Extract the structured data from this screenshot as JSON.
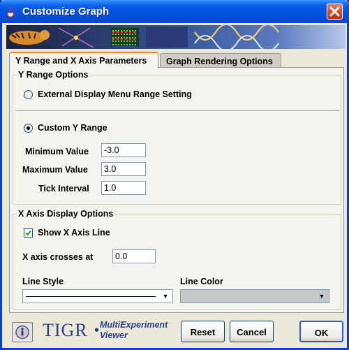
{
  "window": {
    "title": "Customize Graph"
  },
  "tabs": [
    {
      "label": "Y Range and X Axis Parameters",
      "active": true
    },
    {
      "label": "Graph Rendering Options",
      "active": false
    }
  ],
  "y_range": {
    "group_title": "Y Range Options",
    "external_option_label": "External Display Menu Range Setting",
    "external_selected": false,
    "custom_option_label": "Custom Y Range",
    "custom_selected": true,
    "min_label": "Minimum Value",
    "min_value": "-3.0",
    "max_label": "Maximum Value",
    "max_value": "3.0",
    "tick_label": "Tick Interval",
    "tick_value": "1.0"
  },
  "x_axis": {
    "group_title": "X Axis Display Options",
    "show_line_label": "Show X Axis Line",
    "show_line_checked": true,
    "crosses_label": "X axis crosses at",
    "crosses_value": "0.0",
    "line_style_label": "Line Style",
    "line_color_label": "Line Color"
  },
  "footer": {
    "logo_text": "TIGR",
    "logo_sub_line1": "MultiExperiment",
    "logo_sub_line2": "Viewer",
    "reset_label": "Reset",
    "cancel_label": "Cancel",
    "ok_label": "OK"
  },
  "icons": {
    "app": "java-cup-icon",
    "close": "close-icon",
    "info": "info-icon",
    "dropdown": "chevron-down-icon"
  },
  "colors": {
    "titlebar": "#0150de",
    "close_button": "#d6421f",
    "panel": "#f4f3ee",
    "window": "#ece9d8"
  }
}
